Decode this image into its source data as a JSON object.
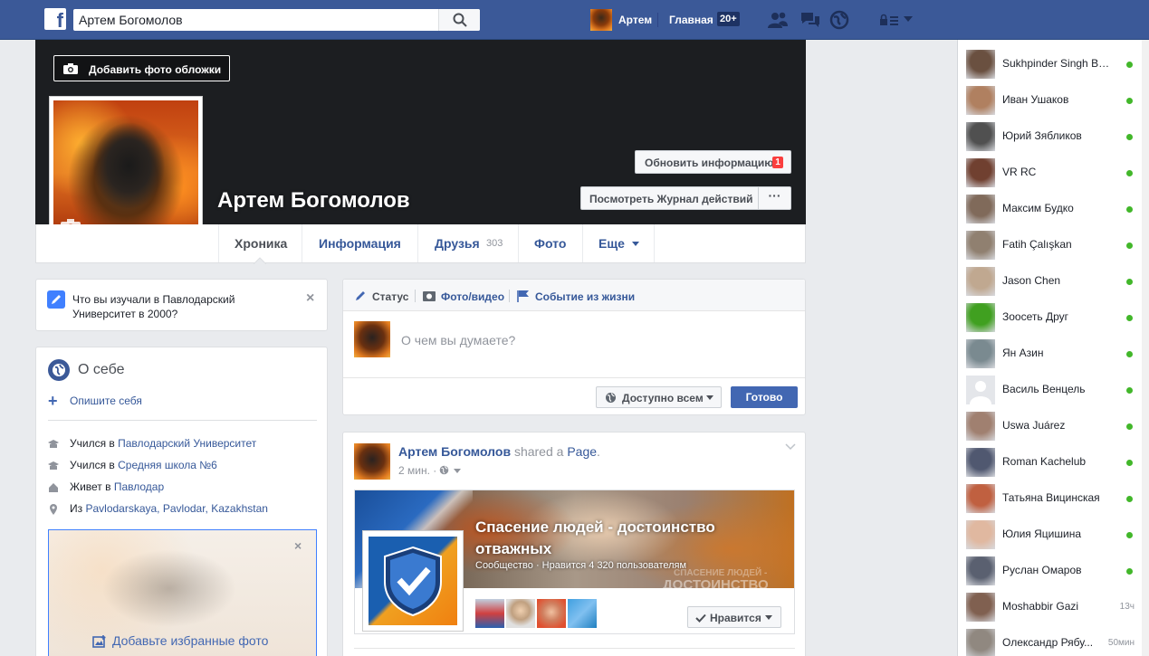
{
  "colors": {
    "brand": "#3b5998",
    "link": "#365899",
    "button_blue": "#4267b2",
    "online_green": "#42b72a",
    "badge_red": "#fa3e3e"
  },
  "topbar": {
    "logo": "f",
    "search_value": "Артем Богомолов",
    "user_name": "Артем",
    "home_label": "Главная",
    "home_badge": "20+"
  },
  "cover": {
    "add_cover_label": "Добавить фото обложки",
    "profile_name": "Артем Богомолов",
    "update_info_label": "Обновить информацию",
    "update_info_badge": "1",
    "activity_log_label": "Посмотреть Журнал действий",
    "more_label": "···"
  },
  "tabs": [
    {
      "label": "Хроника",
      "count": ""
    },
    {
      "label": "Информация",
      "count": ""
    },
    {
      "label": "Друзья",
      "count": "303"
    },
    {
      "label": "Фото",
      "count": ""
    },
    {
      "label": "Еще",
      "count": ""
    }
  ],
  "prompt": {
    "text": "Что вы изучали в Павлодарский Университет в 2000?",
    "close": "×"
  },
  "about": {
    "title": "О себе",
    "describe_label": "Опишите себя",
    "rows": [
      {
        "icon": "education-icon",
        "pre": "Учился в ",
        "link": "Павлодарский Университет"
      },
      {
        "icon": "school-icon",
        "pre": "Учился в ",
        "link": "Средняя школа №6"
      },
      {
        "icon": "home-icon",
        "pre": "Живет в ",
        "link": "Павлодар"
      },
      {
        "icon": "location-pin-icon",
        "pre": "Из ",
        "link": "Pavlodarskaya, Pavlodar, Kazakhstan"
      }
    ],
    "featured_close": "×",
    "featured_add_label": "Добавьте избранные фото"
  },
  "composer": {
    "tab_status": "Статус",
    "tab_photo": "Фото/видео",
    "tab_event": "Событие из жизни",
    "placeholder": "О чем вы думаете?",
    "privacy_label": "Доступно всем",
    "post_label": "Готово"
  },
  "post": {
    "author": "Артем Богомолов",
    "action": " shared a ",
    "object": "Page",
    "object_suffix": ".",
    "time": "2 мин. ·",
    "page_title": "Спасение людей - достоинство отважных",
    "page_subtitle": "Сообщество · Нравится 4 320 пользователям",
    "cover_overlay_small": "СПАСЕНИЕ ЛЮДЕЙ -",
    "cover_overlay_big": "ДОСТОИНСТВО",
    "like_label": "Нравится"
  },
  "chat": [
    {
      "name": "Sukhpinder Singh Bai...",
      "status": "online",
      "time": "",
      "color": "#6a5040"
    },
    {
      "name": "Иван Ушаков",
      "status": "online",
      "time": "",
      "color": "#b08060"
    },
    {
      "name": "Юрий Зябликов",
      "status": "online",
      "time": "",
      "color": "#505050"
    },
    {
      "name": "VR RC",
      "status": "online",
      "time": "",
      "color": "#704030"
    },
    {
      "name": "Максим Будко",
      "status": "online",
      "time": "",
      "color": "#806a5a"
    },
    {
      "name": "Fatih Çalışkan",
      "status": "online",
      "time": "",
      "color": "#908070"
    },
    {
      "name": "Jason Chen",
      "status": "online",
      "time": "",
      "color": "#c0a890"
    },
    {
      "name": "Зоосеть Друг",
      "status": "online",
      "time": "",
      "color": "#40a020"
    },
    {
      "name": "Ян Азин",
      "status": "online",
      "time": "",
      "color": "#7a8a90"
    },
    {
      "name": "Василь Венцель",
      "status": "online",
      "time": "",
      "color": "#e4e6ea"
    },
    {
      "name": "Uswa Juárez",
      "status": "online",
      "time": "",
      "color": "#a08070"
    },
    {
      "name": "Roman Kachelub",
      "status": "online",
      "time": "",
      "color": "#505870"
    },
    {
      "name": "Татьяна Вицинская",
      "status": "online",
      "time": "",
      "color": "#c06040"
    },
    {
      "name": "Юлия Яцишина",
      "status": "online",
      "time": "",
      "color": "#e0b8a0"
    },
    {
      "name": "Руслан Омаров",
      "status": "online",
      "time": "",
      "color": "#5a6070"
    },
    {
      "name": "Moshabbir Gazi",
      "status": "idle",
      "time": "13ч",
      "color": "#806050"
    },
    {
      "name": "Олександр Рябу...",
      "status": "idle",
      "time": "50мин",
      "color": "#908880"
    }
  ]
}
